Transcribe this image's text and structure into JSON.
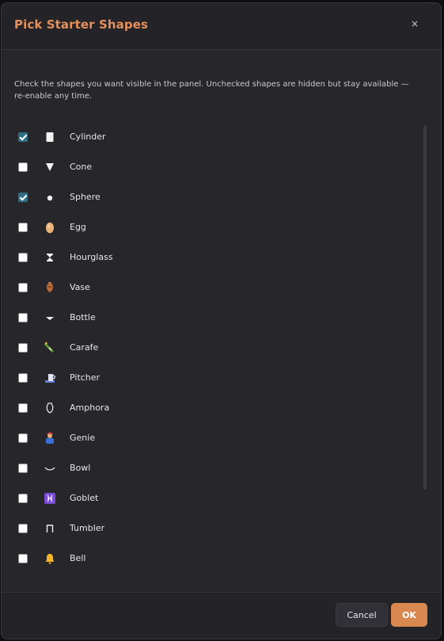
{
  "dialog": {
    "title": "Pick Starter Shapes",
    "close_label": "×",
    "description": "Check the shapes you want visible in the panel. Unchecked shapes are hidden but stay available — re-enable any time."
  },
  "shapes": [
    {
      "label": "Cylinder",
      "checked": true,
      "icon": "cylinder-icon"
    },
    {
      "label": "Cone",
      "checked": false,
      "icon": "cone-icon"
    },
    {
      "label": "Sphere",
      "checked": true,
      "icon": "sphere-icon"
    },
    {
      "label": "Egg",
      "checked": false,
      "icon": "egg-icon"
    },
    {
      "label": "Hourglass",
      "checked": false,
      "icon": "hourglass-icon"
    },
    {
      "label": "Vase",
      "checked": false,
      "icon": "vase-icon"
    },
    {
      "label": "Bottle",
      "checked": false,
      "icon": "bottle-icon"
    },
    {
      "label": "Carafe",
      "checked": false,
      "icon": "carafe-icon"
    },
    {
      "label": "Pitcher",
      "checked": false,
      "icon": "pitcher-icon"
    },
    {
      "label": "Amphora",
      "checked": false,
      "icon": "amphora-icon"
    },
    {
      "label": "Genie",
      "checked": false,
      "icon": "genie-icon"
    },
    {
      "label": "Bowl",
      "checked": false,
      "icon": "bowl-icon"
    },
    {
      "label": "Goblet",
      "checked": false,
      "icon": "goblet-icon"
    },
    {
      "label": "Tumbler",
      "checked": false,
      "icon": "tumbler-icon"
    },
    {
      "label": "Bell",
      "checked": false,
      "icon": "bell-icon"
    }
  ],
  "footer": {
    "cancel_label": "Cancel",
    "ok_label": "OK"
  },
  "colors": {
    "accent": "#e58f5c",
    "ok_button": "#d9894f",
    "checkbox_checked": "#2f6f86",
    "panel_bg": "#26262b"
  }
}
